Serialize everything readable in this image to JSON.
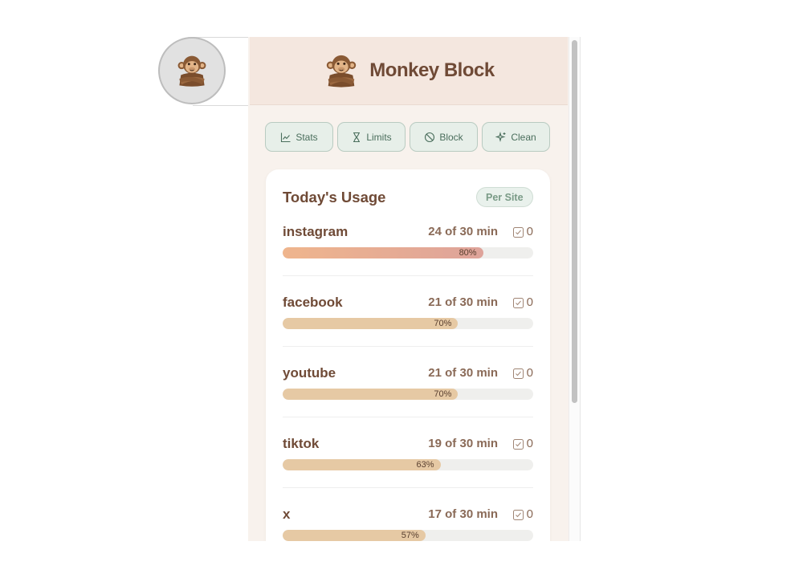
{
  "app": {
    "title": "Monkey Block",
    "logo_icon": "monkey-icon"
  },
  "nav": [
    {
      "label": "Stats",
      "icon": "line-chart-icon"
    },
    {
      "label": "Limits",
      "icon": "hourglass-icon"
    },
    {
      "label": "Block",
      "icon": "block-icon"
    },
    {
      "label": "Clean",
      "icon": "sparkles-icon"
    }
  ],
  "usage": {
    "title": "Today's Usage",
    "badge": "Per Site",
    "sites": [
      {
        "name": "instagram",
        "usage": "24 of 30 min",
        "count": "0",
        "percent_label": "80%",
        "fraction": 0.8,
        "level": "hot"
      },
      {
        "name": "facebook",
        "usage": "21 of 30 min",
        "count": "0",
        "percent_label": "70%",
        "fraction": 0.7,
        "level": "normal"
      },
      {
        "name": "youtube",
        "usage": "21 of 30 min",
        "count": "0",
        "percent_label": "70%",
        "fraction": 0.7,
        "level": "normal"
      },
      {
        "name": "tiktok",
        "usage": "19 of 30 min",
        "count": "0",
        "percent_label": "63%",
        "fraction": 0.63,
        "level": "normal"
      },
      {
        "name": "x",
        "usage": "17 of 30 min",
        "count": "0",
        "percent_label": "57%",
        "fraction": 0.57,
        "level": "normal"
      }
    ]
  },
  "colors": {
    "brand": "#6f4a36",
    "accent_green": "#7a9b87",
    "bar_fill": "#e6c9a4",
    "bar_hot_start": "#efb58d",
    "bar_hot_end": "#dea39a"
  }
}
